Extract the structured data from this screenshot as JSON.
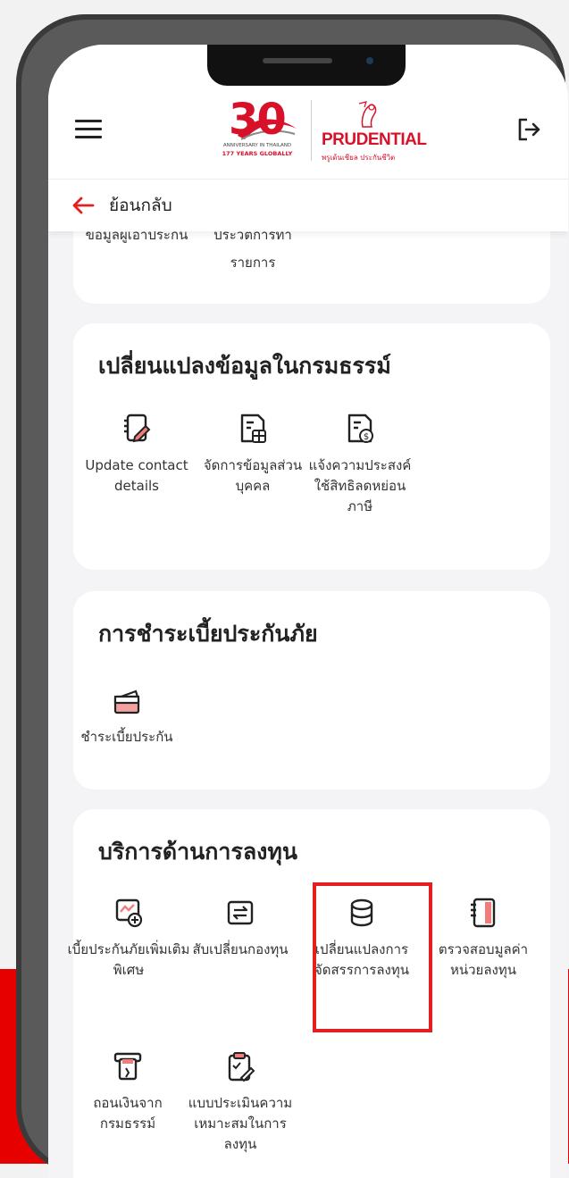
{
  "header": {
    "logo30": {
      "big": "30",
      "line1": "ANNIVERSARY IN THAILAND",
      "line2": "177 YEARS GLOBALLY"
    },
    "brand": {
      "name": "PRUDENTIAL",
      "tagline": "พรูเด้นเชียล ประกันชีวิต"
    }
  },
  "back": {
    "label": "ย้อนกลับ"
  },
  "top_card": {
    "items": [
      {
        "label": "ข้อมูลผู้เอาประกัน"
      },
      {
        "label": "ประวัติการทำรายการ"
      }
    ],
    "visible_fragment": "รายการ"
  },
  "policy_changes": {
    "title": "เปลี่ยนแปลงข้อมูลในกรมธรรม์",
    "items": [
      {
        "label": "Update contact details",
        "icon": "edit-contact-icon"
      },
      {
        "label": "จัดการข้อมูลส่วนบุคคล",
        "icon": "personal-data-icon"
      },
      {
        "label": "แจ้งความประสงค์ใช้สิทธิลดหย่อนภาษี",
        "icon": "tax-document-icon"
      }
    ]
  },
  "premium_payment": {
    "title": "การชำระเบี้ยประกันภัย",
    "items": [
      {
        "label": "ชำระเบี้ยประกัน",
        "icon": "payment-icon"
      }
    ]
  },
  "investment_services": {
    "title": "บริการด้านการลงทุน",
    "items": [
      {
        "label": "เบี้ยประกันภัยเพิ่มเติมพิเศษ",
        "icon": "top-up-icon"
      },
      {
        "label": "สับเปลี่ยนกองทุน",
        "icon": "switch-fund-icon"
      },
      {
        "label": "เปลี่ยนแปลงการจัดสรรการลงทุน",
        "icon": "allocation-database-icon"
      },
      {
        "label": "ตรวจสอบมูลค่าหน่วยลงทุน",
        "icon": "unit-value-book-icon"
      },
      {
        "label": "ถอนเงินจากกรมธรรม์",
        "icon": "withdraw-icon"
      },
      {
        "label": "แบบประเมินความเหมาะสมในการลงทุน",
        "icon": "suitability-clipboard-icon"
      }
    ]
  },
  "colors": {
    "accent": "#d8112a",
    "highlight": "#e32020",
    "background": "#f4f4f6",
    "card": "#ffffff"
  }
}
